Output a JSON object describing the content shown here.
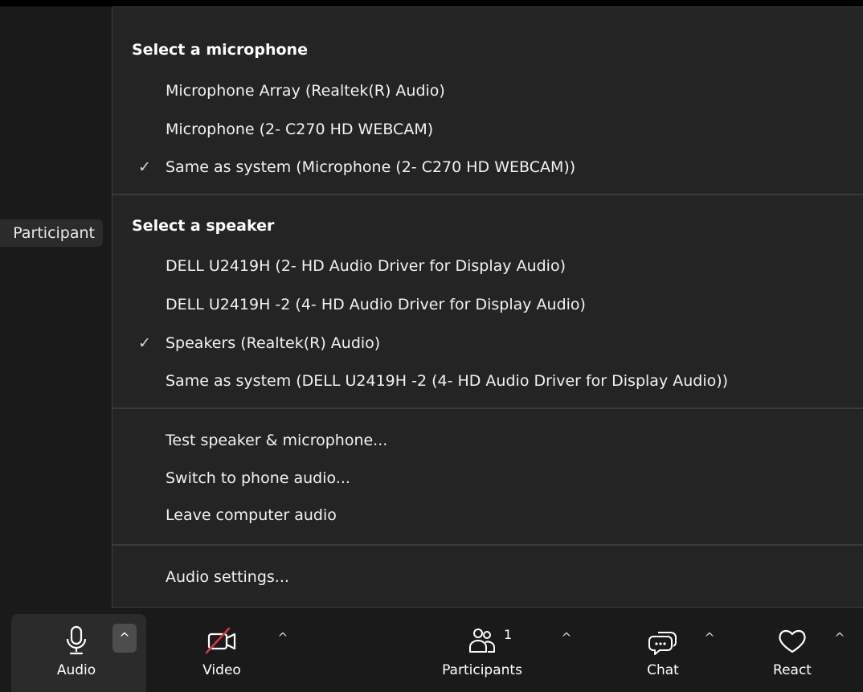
{
  "participant_tile": {
    "label": "Participant"
  },
  "menu": {
    "microphone": {
      "heading": "Select a microphone",
      "items": [
        {
          "label": "Microphone Array (Realtek(R) Audio)",
          "check": ""
        },
        {
          "label": "Microphone (2- C270 HD WEBCAM)",
          "check": ""
        },
        {
          "label": "Same as system (Microphone (2- C270 HD WEBCAM))",
          "check": "✓"
        }
      ]
    },
    "speaker": {
      "heading": "Select a speaker",
      "items": [
        {
          "label": "DELL U2419H (2- HD Audio Driver for Display Audio)",
          "check": ""
        },
        {
          "label": "DELL U2419H -2 (4- HD Audio Driver for Display Audio)",
          "check": ""
        },
        {
          "label": "Speakers (Realtek(R) Audio)",
          "check": "✓"
        },
        {
          "label": "Same as system (DELL U2419H -2 (4- HD Audio Driver for Display Audio))",
          "check": ""
        }
      ]
    },
    "actions": [
      {
        "label": "Test speaker & microphone..."
      },
      {
        "label": "Switch to phone audio..."
      },
      {
        "label": "Leave computer audio"
      }
    ],
    "settings": {
      "label": "Audio settings..."
    }
  },
  "toolbar": {
    "audio": {
      "label": "Audio",
      "icon": "microphone-icon",
      "caret": "^"
    },
    "video": {
      "label": "Video",
      "icon": "video-off-icon",
      "caret": "^"
    },
    "participants": {
      "label": "Participants",
      "icon": "participants-icon",
      "count": "1",
      "caret": "^"
    },
    "chat": {
      "label": "Chat",
      "icon": "chat-icon",
      "caret": "^"
    },
    "react": {
      "label": "React",
      "icon": "heart-icon",
      "caret": "^"
    }
  },
  "colors": {
    "menu_background": "#242424",
    "toolbar_background": "#1a1a1a",
    "video_off_slash": "#e0304a"
  }
}
